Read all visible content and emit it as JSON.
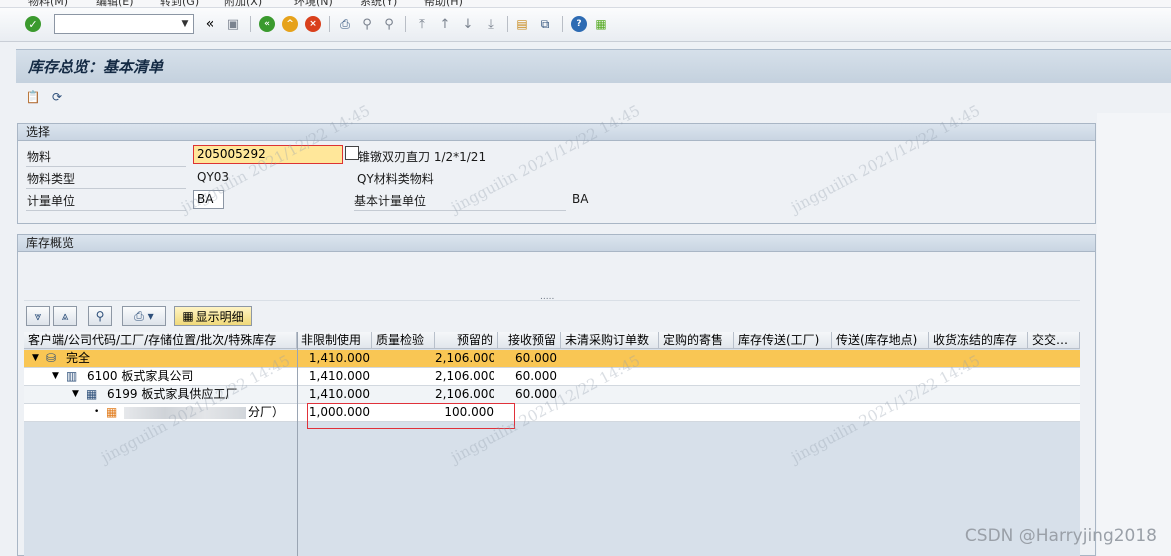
{
  "menu": [
    "物料(M)",
    "编辑(E)",
    "转到(G)",
    "附加(X)",
    "环境(N)",
    "系统(Y)",
    "帮助(H)"
  ],
  "toolbar": {
    "command_value": "",
    "icons": [
      "enter-icon",
      "save-icon",
      "back-icon",
      "exit-icon",
      "cancel-icon",
      "print-icon",
      "find-icon",
      "find-next-icon",
      "first-page-icon",
      "prev-page-icon",
      "next-page-icon",
      "last-page-icon",
      "new-session-icon",
      "shortcut-icon",
      "help-icon",
      "layout-icon"
    ]
  },
  "title": "库存总览：基本清单",
  "selection": {
    "heading": "选择",
    "material_label": "物料",
    "material_value": "205005292",
    "material_desc": "锥镦双刃直刀 1/2*1/21",
    "material_type_label": "物料类型",
    "material_type_value": "QY03",
    "material_type_desc": "QY材料类物料",
    "uom_label": "计量单位",
    "uom_value": "BA",
    "base_uom_label": "基本计量单位",
    "base_uom_value": "BA"
  },
  "overview": {
    "heading": "库存概览",
    "show_detail_label": "显示明细",
    "splitter": "....."
  },
  "grid": {
    "columns": [
      "客户端/公司代码/工厂/存储位置/批次/特殊库存",
      "非限制使用",
      "质量检验",
      "预留的",
      "接收预留",
      "未清采购订单数",
      "定购的寄售",
      "库存传送(工厂)",
      "传送(库存地点)",
      "收货冻结的库存",
      "交交…"
    ],
    "rows": [
      {
        "node": "完全",
        "unrestricted": "1,410.000",
        "quality": "",
        "reserved": "2,106.000",
        "rcpt_reserved": "60.000"
      },
      {
        "node": "6100 板式家具公司",
        "unrestricted": "1,410.000",
        "quality": "",
        "reserved": "2,106.000",
        "rcpt_reserved": "60.000"
      },
      {
        "node": "6199 板式家具供应工厂",
        "unrestricted": "1,410.000",
        "quality": "",
        "reserved": "2,106.000",
        "rcpt_reserved": "60.000"
      },
      {
        "node": "分厂）",
        "unrestricted": "1,000.000",
        "quality": "",
        "reserved": "100.000",
        "rcpt_reserved": ""
      }
    ]
  },
  "watermark": "jingguilin 2021/12/22 14:45",
  "credit": "CSDN @Harryjing2018"
}
